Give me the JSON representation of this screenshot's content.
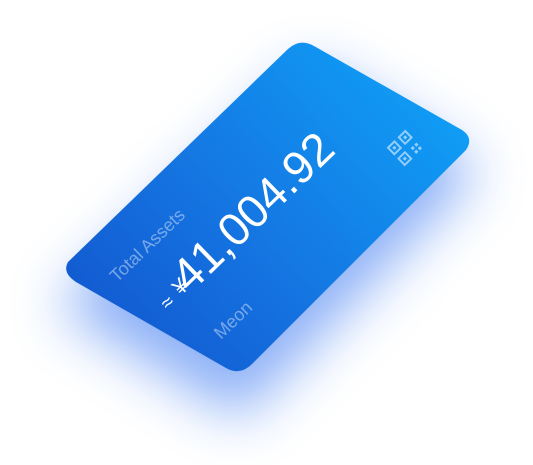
{
  "card": {
    "title": "Total Assets",
    "currency_symbol": "¥",
    "amount": "41,004.92",
    "approx_symbol": "≈",
    "brand": "Meon",
    "qr_icon": "qr-code-icon",
    "colors": {
      "card_top": "#1099f4",
      "card_bottom": "#1258d4",
      "glow": "#2f7cf0"
    }
  }
}
